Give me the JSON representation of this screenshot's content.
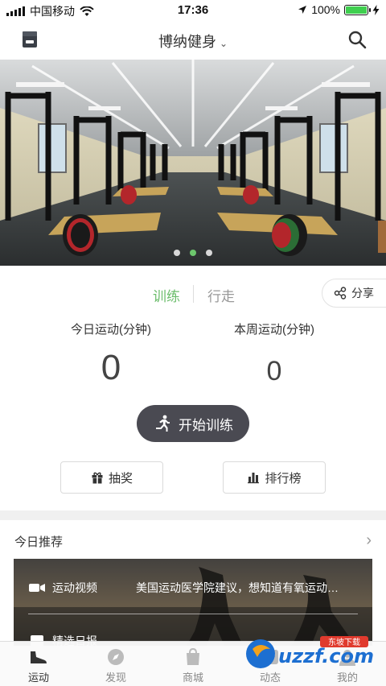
{
  "status_bar": {
    "carrier": "中国移动",
    "time": "17:36",
    "battery": "100%",
    "battery_level": 1.0
  },
  "nav": {
    "title": "博纳健身",
    "left_icon": "clipboard-icon",
    "right_icon": "search-icon"
  },
  "banner": {
    "dot_count": 3,
    "active_dot": 1
  },
  "tabs": {
    "train": "训练",
    "walk": "行走",
    "share": "分享",
    "active_color": "#6cbd6c"
  },
  "stats": {
    "today_label": "今日运动(分钟)",
    "today_value": "0",
    "week_label": "本周运动(分钟)",
    "week_value": "0"
  },
  "actions": {
    "start_training": "开始训练",
    "lottery": "抽奖",
    "leaderboard": "排行榜"
  },
  "recommend": {
    "title": "今日推荐",
    "rows": [
      {
        "label": "运动视频",
        "text": "美国运动医学院建议，想知道有氧运动…",
        "icon": "video-icon"
      },
      {
        "label": "精选日报",
        "text": "",
        "icon": "news-icon"
      }
    ]
  },
  "tabbar": {
    "items": [
      {
        "label": "运动",
        "icon": "shoe-icon",
        "active": true
      },
      {
        "label": "发现",
        "icon": "compass-icon",
        "active": false
      },
      {
        "label": "商城",
        "icon": "bag-icon",
        "active": false
      },
      {
        "label": "动态",
        "icon": "feed-icon",
        "active": false
      },
      {
        "label": "我的",
        "icon": "user-icon",
        "active": false
      }
    ]
  },
  "watermark": "uzzf.com",
  "watermark_sub": "东坡下载",
  "colors": {
    "accent": "#6cbd6c",
    "start_button": "#4a4a52"
  }
}
